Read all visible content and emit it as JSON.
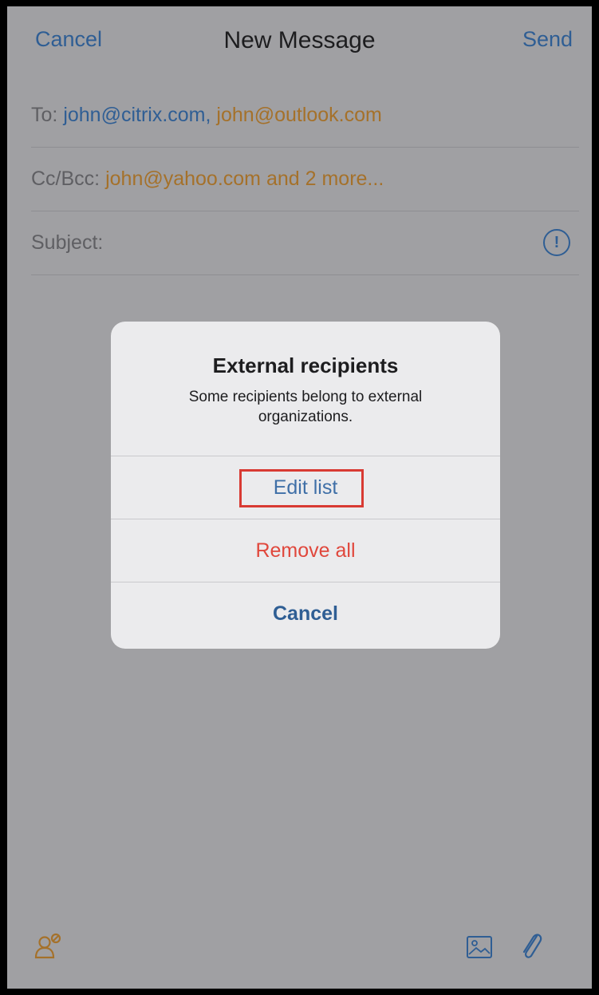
{
  "header": {
    "cancel_label": "Cancel",
    "title": "New Message",
    "send_label": "Send"
  },
  "fields": {
    "to_label": "To:",
    "to_internal": "john@citrix.com",
    "to_separator": ",",
    "to_external": "john@outlook.com",
    "cc_label": "Cc/Bcc:",
    "cc_value": "john@yahoo.com and 2 more...",
    "subject_label": "Subject:",
    "subject_value": ""
  },
  "alert": {
    "title": "External recipients",
    "message": "Some recipients belong to external organizations.",
    "edit_label": "Edit list",
    "remove_label": "Remove all",
    "cancel_label": "Cancel"
  },
  "icons": {
    "info": "info-circle-icon",
    "contacts": "contacts-icon",
    "image": "image-icon",
    "attachment": "paperclip-icon"
  },
  "colors": {
    "link_blue": "#2f5e94",
    "external_orange": "#a5712a",
    "destructive_red": "#e0473c",
    "highlight_red": "#d83a33"
  }
}
